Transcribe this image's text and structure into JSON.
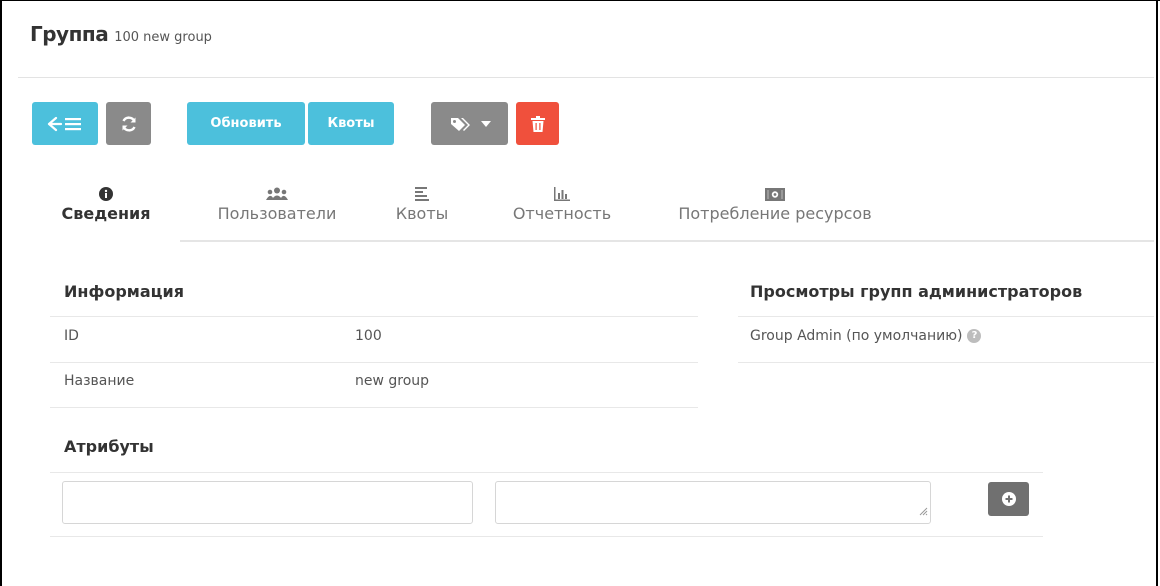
{
  "header": {
    "title": "Группа",
    "subtitle": "100 new group"
  },
  "toolbar": {
    "back_icon": "arrow-left-list-icon",
    "refresh_icon": "refresh-icon",
    "update_label": "Обновить",
    "quotas_label": "Квоты",
    "tags_icon": "tags-icon",
    "delete_icon": "trash-icon",
    "colors": {
      "blue": "#4cc0dc",
      "grey": "#8a8a8a",
      "red": "#f0503c"
    }
  },
  "tabs": [
    {
      "label": "Сведения",
      "icon": "info-icon",
      "active": true
    },
    {
      "label": "Пользователи",
      "icon": "users-icon",
      "active": false
    },
    {
      "label": "Квоты",
      "icon": "align-left-icon",
      "active": false
    },
    {
      "label": "Отчетность",
      "icon": "bar-chart-icon",
      "active": false
    },
    {
      "label": "Потребление ресурсов",
      "icon": "money-icon",
      "active": false
    }
  ],
  "info": {
    "title": "Информация",
    "rows": [
      {
        "key": "ID",
        "value": "100"
      },
      {
        "key": "Название",
        "value": "new group"
      }
    ]
  },
  "admin_views": {
    "title": "Просмотры групп администраторов",
    "item": "Group Admin (по умолчанию)"
  },
  "attributes": {
    "title": "Атрибуты",
    "name_value": "",
    "value_value": ""
  }
}
